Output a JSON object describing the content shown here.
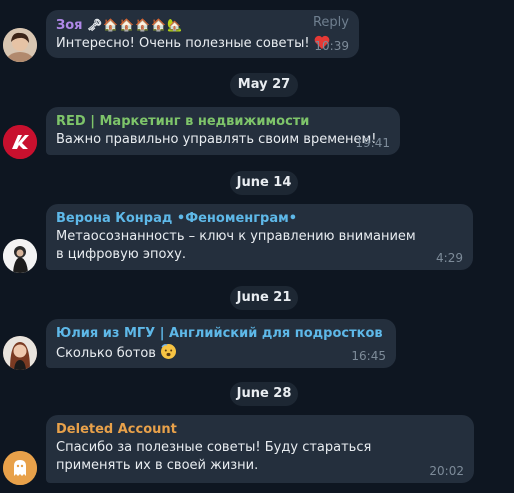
{
  "messages": [
    {
      "sender": "Зоя",
      "sender_color": "#b088e8",
      "text": "Интересно! Очень полезные советы!",
      "time": "10:39",
      "reply_label": "Reply",
      "avatar": "user-photo-zoya"
    },
    {
      "sender": "RED | Маркетинг в недвижимости",
      "sender_color": "#7ec46a",
      "text": "Важно правильно управлять своим временем!",
      "time": "19:41",
      "avatar": "red-logo"
    },
    {
      "sender": "Верона Конрад •Феноменграм•",
      "sender_color": "#5eb8e8",
      "text": "Метаосознанность – ключ к управлению вниманием в цифровую эпоху.",
      "time": "4:29",
      "avatar": "user-photo-verona"
    },
    {
      "sender": "Юлия из МГУ | Английский для подростков",
      "sender_color": "#5eb8e8",
      "text": "Сколько ботов",
      "time": "16:45",
      "avatar": "user-photo-yulia"
    },
    {
      "sender": "Deleted Account",
      "sender_color": "#e8a14a",
      "text": "Спасибо за полезные советы! Буду стараться применять их в своей жизни.",
      "time": "20:02",
      "avatar": "ghost-icon"
    }
  ],
  "dates": [
    "May 27",
    "June 14",
    "June 21",
    "June 28"
  ],
  "colors": {
    "background": "#0e1621",
    "bubble": "#242f3d",
    "date_pill": "#1d2733",
    "heart": "#e53935",
    "red_logo_bg": "#c8102e",
    "deleted_avatar_bg": "#e8a14a"
  }
}
